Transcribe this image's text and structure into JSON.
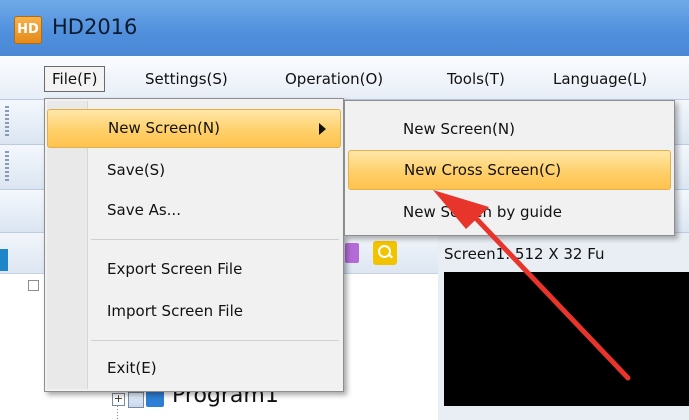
{
  "app": {
    "title": "HD2016",
    "icon": "app-icon",
    "icon_glyph": "HD"
  },
  "menubar": {
    "items": [
      {
        "label": "File(F)"
      },
      {
        "label": "Settings(S)"
      },
      {
        "label": "Operation(O)"
      },
      {
        "label": "Tools(T)"
      },
      {
        "label": "Language(L)"
      }
    ]
  },
  "file_menu": {
    "items": [
      {
        "label": "New Screen(N)"
      },
      {
        "label": "Save(S)"
      },
      {
        "label": "Save As..."
      },
      {
        "label": "Export Screen File"
      },
      {
        "label": "Import Screen File"
      },
      {
        "label": "Exit(E)"
      }
    ]
  },
  "new_screen_submenu": {
    "items": [
      {
        "label": "New Screen(N)"
      },
      {
        "label": "New Cross Screen(C)"
      },
      {
        "label": "New Screen by guide"
      }
    ]
  },
  "tree": {
    "program_label": "Program1"
  },
  "screen": {
    "header": "Screen1: 512 X 32  Fu"
  },
  "colors": {
    "highlight": "#ffd06a",
    "annotation_arrow": "#e8352c",
    "titlebar": "#4f8fdc"
  }
}
